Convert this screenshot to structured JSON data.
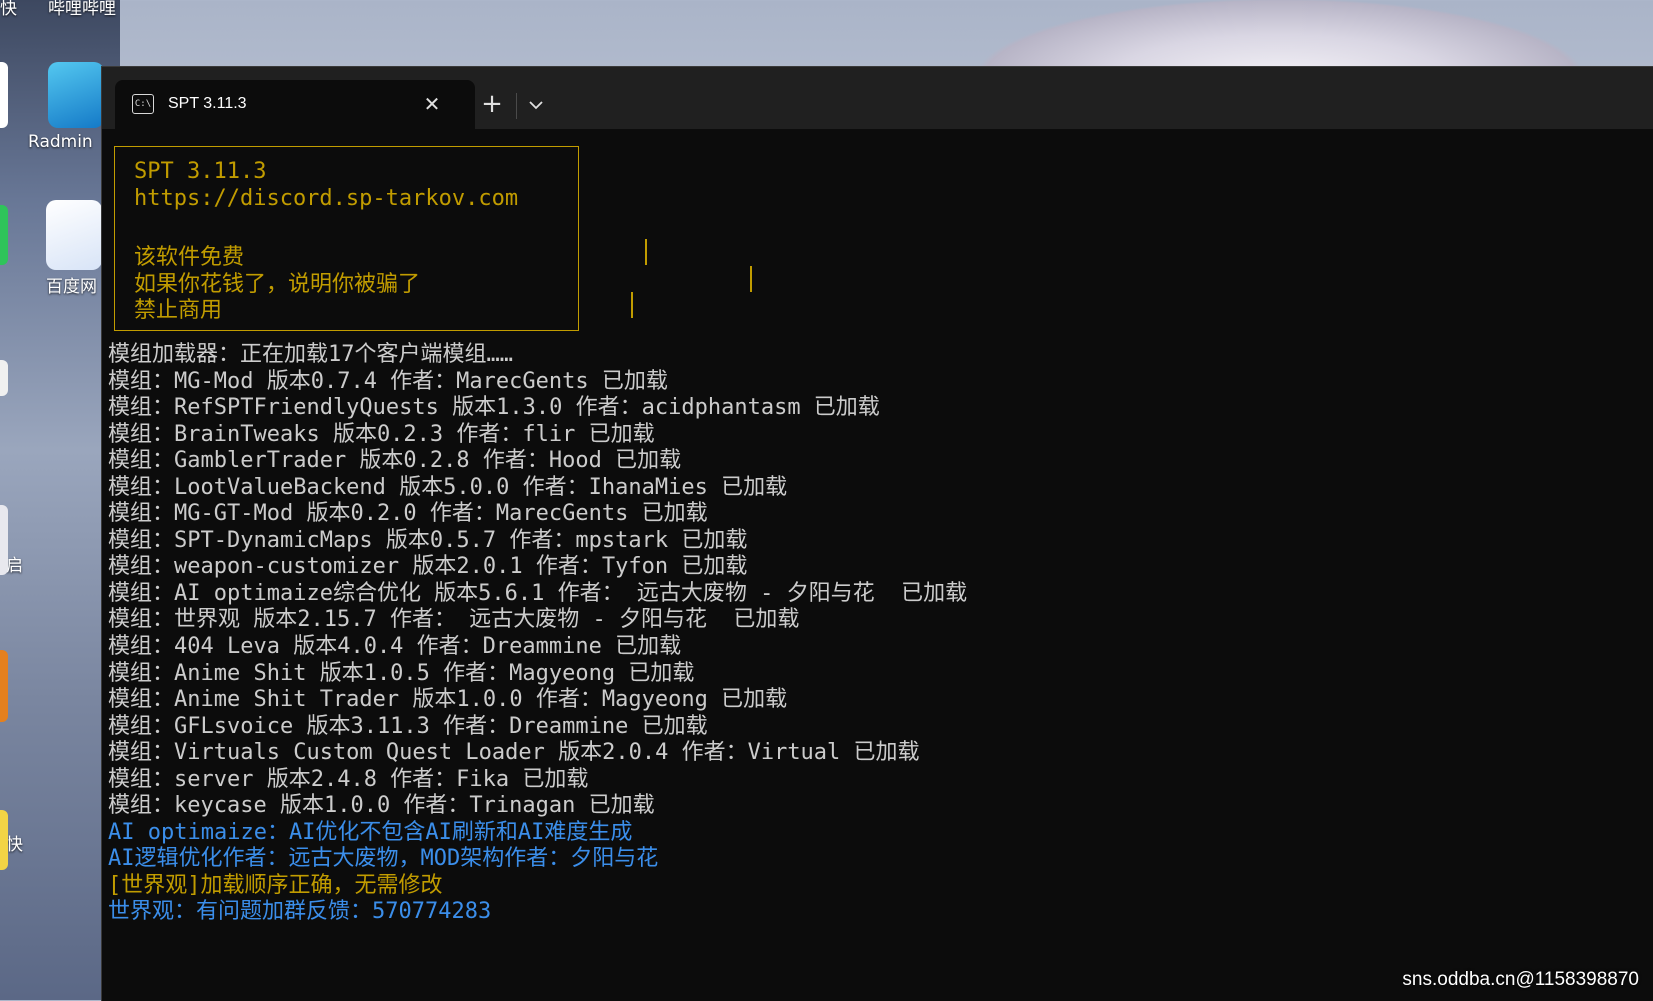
{
  "desktop": {
    "labels": [
      "哔哩哔哩",
      "Radmin",
      "百度网",
      "启",
      "快",
      "快"
    ],
    "watermark": "sns.oddba.cn@1158398870"
  },
  "window": {
    "tab_title": "SPT 3.11.3",
    "tab_icon": "terminal-icon",
    "close_glyph": "✕",
    "new_tab_glyph": "+",
    "dropdown_glyph": "⌄"
  },
  "banner": {
    "lines": [
      "SPT 3.11.3",
      "https://discord.sp-tarkov.com",
      "",
      "该软件免费",
      "如果你花钱了，说明你被骗了",
      "禁止商用"
    ],
    "color": "#c19c00"
  },
  "log": [
    {
      "text": "模组加载器：正在加载17个客户端模组……",
      "color": "default"
    },
    {
      "text": "模组：MG-Mod 版本0.7.4 作者：MarecGents 已加载",
      "color": "default"
    },
    {
      "text": "模组：RefSPTFriendlyQuests 版本1.3.0 作者：acidphantasm 已加载",
      "color": "default"
    },
    {
      "text": "模组：BrainTweaks 版本0.2.3 作者：flir 已加载",
      "color": "default"
    },
    {
      "text": "模组：GamblerTrader 版本0.2.8 作者：Hood 已加载",
      "color": "default"
    },
    {
      "text": "模组：LootValueBackend 版本5.0.0 作者：IhanaMies 已加载",
      "color": "default"
    },
    {
      "text": "模组：MG-GT-Mod 版本0.2.0 作者：MarecGents 已加载",
      "color": "default"
    },
    {
      "text": "模组：SPT-DynamicMaps 版本0.5.7 作者：mpstark 已加载",
      "color": "default"
    },
    {
      "text": "模组：weapon-customizer 版本2.0.1 作者：Tyfon 已加载",
      "color": "default"
    },
    {
      "text": "模组：AI optimaize综合优化 版本5.6.1 作者： 远古大废物 - 夕阳与花  已加载",
      "color": "default"
    },
    {
      "text": "模组：世界观 版本2.15.7 作者： 远古大废物 - 夕阳与花  已加载",
      "color": "default"
    },
    {
      "text": "模组：404 Leva 版本4.0.4 作者：Dreammine 已加载",
      "color": "default"
    },
    {
      "text": "模组：Anime Shit 版本1.0.5 作者：Magyeong 已加载",
      "color": "default"
    },
    {
      "text": "模组：Anime Shit Trader 版本1.0.0 作者：Magyeong 已加载",
      "color": "default"
    },
    {
      "text": "模组：GFLsvoice 版本3.11.3 作者：Dreammine 已加载",
      "color": "default"
    },
    {
      "text": "模组：Virtuals Custom Quest Loader 版本2.0.4 作者：Virtual 已加载",
      "color": "default"
    },
    {
      "text": "模组：server 版本2.4.8 作者：Fika 已加载",
      "color": "default"
    },
    {
      "text": "模组：keycase 版本1.0.0 作者：Trinagan 已加载",
      "color": "default"
    },
    {
      "text": "AI optimaize：AI优化不包含AI刷新和AI难度生成",
      "color": "blue"
    },
    {
      "text": "AI逻辑优化作者：远古大废物，MOD架构作者：夕阳与花",
      "color": "blue"
    },
    {
      "text": "[世界观]加载顺序正确，无需修改",
      "color": "yellow"
    },
    {
      "text": "世界观：有问题加群反馈：570774283",
      "color": "blue"
    }
  ],
  "colors": {
    "default_text": "#cccccc",
    "blue_text": "#3b8eea",
    "yellow_text": "#c19c00",
    "terminal_bg": "#0c0c0c",
    "tabbar_bg": "#202020"
  }
}
